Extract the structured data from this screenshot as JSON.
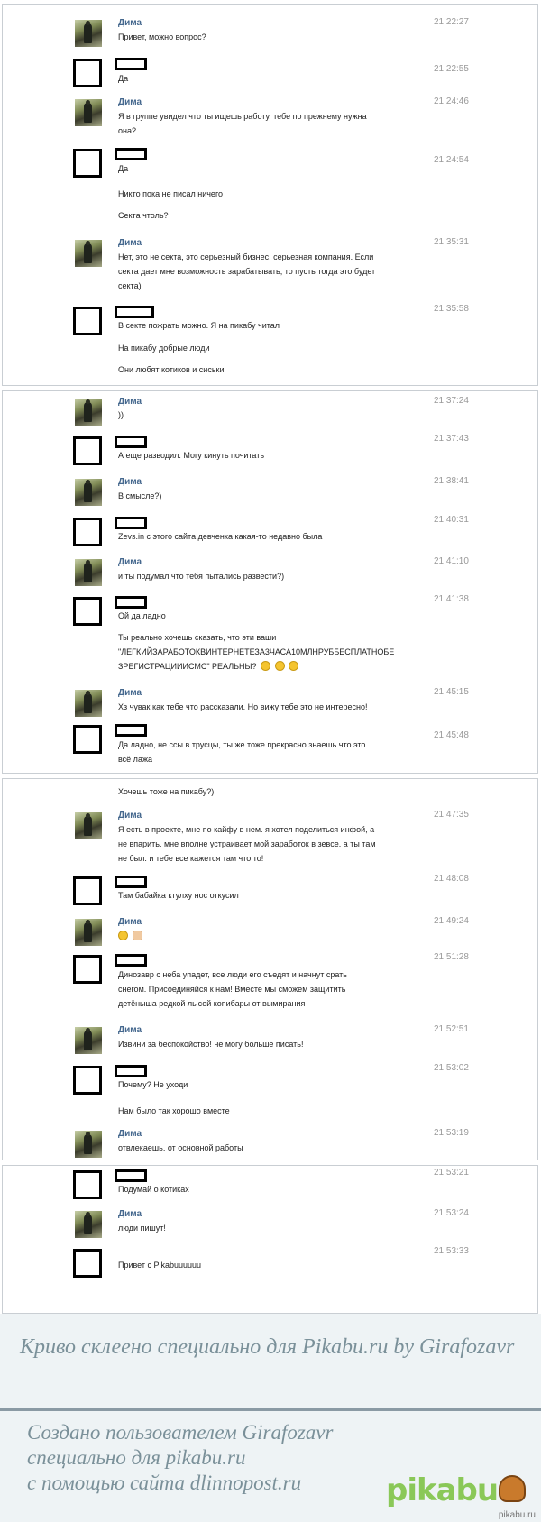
{
  "panels": [
    {
      "messages": [
        {
          "from": "dima",
          "name": "Дима",
          "time": "21:22:27",
          "lines": [
            "Привет, можно вопрос?"
          ]
        },
        {
          "from": "me",
          "time": "21:22:55",
          "lines": [
            "Да"
          ]
        },
        {
          "from": "dima",
          "name": "Дима",
          "time": "21:24:46",
          "lines": [
            "Я в группе увидел что ты ищешь работу, тебе по прежнему нужна",
            "она?"
          ]
        },
        {
          "from": "me",
          "time": "21:24:54",
          "lines": [
            "Да"
          ]
        },
        {
          "from": "me",
          "time": "",
          "lines": [
            "Никто пока не писал ничего"
          ]
        },
        {
          "from": "me",
          "time": "",
          "lines": [
            "Секта чтоль?"
          ]
        },
        {
          "from": "dima",
          "name": "Дима",
          "time": "21:35:31",
          "lines": [
            "Нет, это не секта, это серьезный бизнес, серьезная компания. Если",
            "секта дает мне возможность зарабатывать, то пусть тогда это будет",
            "секта)"
          ]
        },
        {
          "from": "me",
          "time": "21:35:58",
          "lines": [
            "В секте пожрать можно. Я на пикабу читал"
          ]
        },
        {
          "from": "me",
          "time": "",
          "lines": [
            "На пикабу добрые люди"
          ]
        },
        {
          "from": "me",
          "time": "",
          "lines": [
            "Они любят котиков и сиськи"
          ]
        }
      ]
    },
    {
      "messages": [
        {
          "from": "dima",
          "name": "Дима",
          "time": "21:37:24",
          "lines": [
            "))"
          ]
        },
        {
          "from": "me",
          "time": "21:37:43",
          "lines": [
            "А еще разводил. Могу кинуть почитать"
          ]
        },
        {
          "from": "dima",
          "name": "Дима",
          "time": "21:38:41",
          "lines": [
            "В смысле?)"
          ]
        },
        {
          "from": "me",
          "time": "21:40:31",
          "lines": [
            "Zevs.in с этого сайта девченка какая-то недавно была"
          ]
        },
        {
          "from": "dima",
          "name": "Дима",
          "time": "21:41:10",
          "lines": [
            "и ты подумал что тебя пытались развести?)"
          ]
        },
        {
          "from": "me",
          "time": "21:41:38",
          "lines": [
            "Ой да ладно"
          ]
        },
        {
          "from": "me",
          "time": "",
          "lines": [
            "Ты реально хочешь сказать, что эти ваши",
            "\"ЛЕГКИЙЗАРАБОТОКВИНТЕРНЕТЕЗА3ЧАСА10МЛНРУББЕСПЛАТНОБЕ",
            "ЗРЕГИСТРАЦИИИСМС\" РЕАЛЬНЫ?"
          ]
        },
        {
          "from": "dima",
          "name": "Дима",
          "time": "21:45:15",
          "lines": [
            "Хз чувак как тебе что рассказали. Но вижу тебе это не интересно!"
          ]
        },
        {
          "from": "me",
          "time": "21:45:48",
          "lines": [
            "Да ладно, не ссы в трусцы, ты же тоже прекрасно знаешь что это",
            "всё лажа"
          ]
        }
      ]
    },
    {
      "messages": [
        {
          "from": "me",
          "time": "",
          "lines": [
            "Хочешь тоже на пикабу?)"
          ]
        },
        {
          "from": "dima",
          "name": "Дима",
          "time": "21:47:35",
          "lines": [
            "Я есть в проекте, мне по кайфу в нем. я хотел поделиться инфой, а",
            "не впарить. мне вполне устраивает мой заработок в зевсе. а ты там",
            "не был. и тебе все кажется там что то!"
          ]
        },
        {
          "from": "me",
          "time": "21:48:08",
          "lines": [
            "Там бабайка ктулху нос откусил"
          ]
        },
        {
          "from": "dima",
          "name": "Дима",
          "time": "21:49:24",
          "lines": [
            ""
          ]
        },
        {
          "from": "me",
          "time": "21:51:28",
          "lines": [
            "Динозавр с неба упадет, все люди его съедят и начнут срать",
            "снегом. Присоединяйся к нам! Вместе мы сможем защитить",
            "детёныша редкой лысой копибары от вымирания"
          ]
        },
        {
          "from": "dima",
          "name": "Дима",
          "time": "21:52:51",
          "lines": [
            "Извини за беспокойство! не могу больше писать!"
          ]
        },
        {
          "from": "me",
          "time": "21:53:02",
          "lines": [
            "Почему? Не уходи"
          ]
        },
        {
          "from": "me",
          "time": "",
          "lines": [
            "Нам было так хорошо вместе"
          ]
        },
        {
          "from": "dima",
          "name": "Дима",
          "time": "21:53:19",
          "lines": [
            "отвлекаешь. от основной работы"
          ]
        }
      ]
    },
    {
      "messages": [
        {
          "from": "me",
          "time": "21:53:21",
          "lines": [
            "Подумай о котиках"
          ]
        },
        {
          "from": "dima",
          "name": "Дима",
          "time": "21:53:24",
          "lines": [
            "люди пишут!"
          ]
        },
        {
          "from": "me",
          "time": "21:53:33",
          "lines": [
            "Привет с Pikabuuuuuu"
          ]
        }
      ]
    }
  ],
  "footer": {
    "caption": "Криво склеено специально для Pikabu.ru by Girafozavr",
    "credit_lines": [
      "Создано пользователем Girafozavr",
      "специально для pikabu.ru",
      "с помощью сайта dlinnopost.ru"
    ],
    "logo_text": "pikabu",
    "watermark": "pikabu.ru"
  }
}
